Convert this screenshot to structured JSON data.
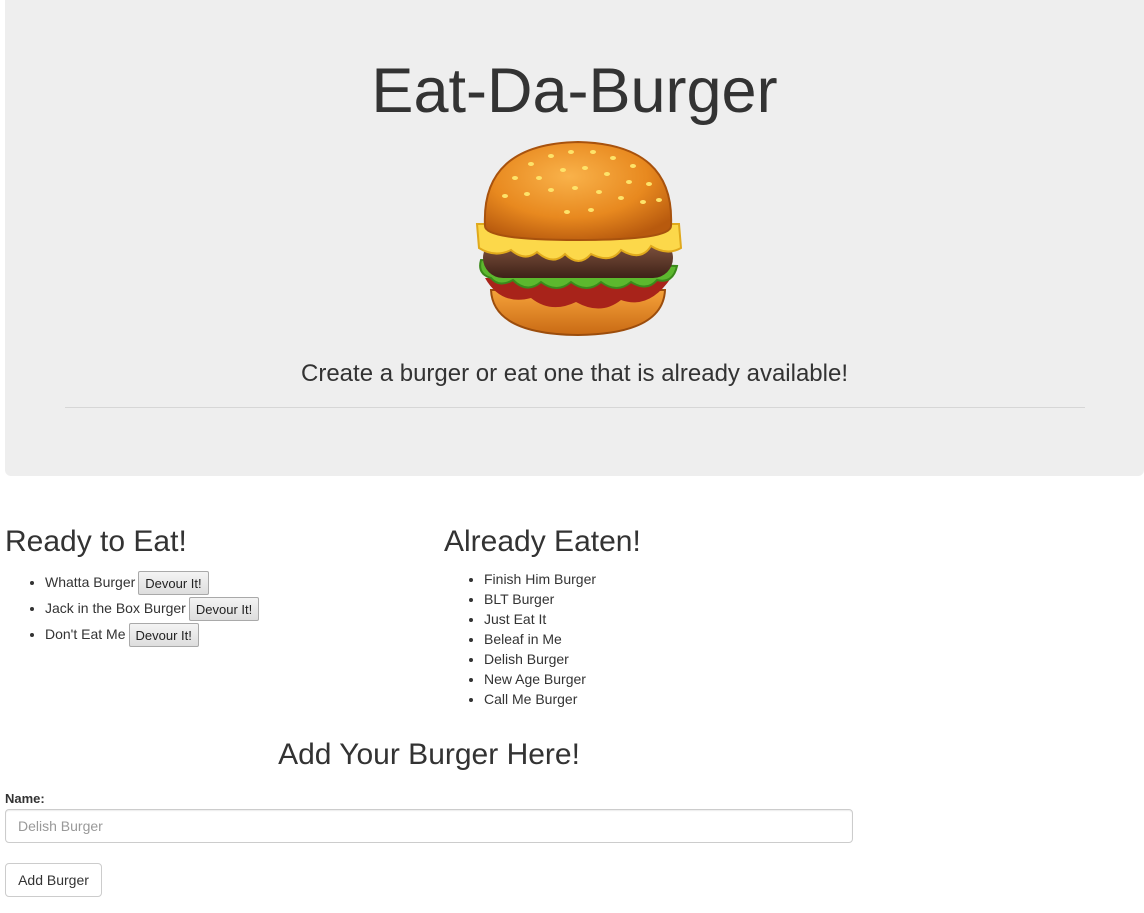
{
  "header": {
    "title": "Eat-Da-Burger",
    "tagline": "Create a burger or eat one that is already available!"
  },
  "logo": {
    "icon": "hamburger-icon"
  },
  "ready": {
    "heading": "Ready to Eat!",
    "items": [
      {
        "name": "Whatta Burger",
        "button": "Devour It!"
      },
      {
        "name": "Jack in the Box Burger",
        "button": "Devour It!"
      },
      {
        "name": "Don't Eat Me",
        "button": "Devour It!"
      }
    ]
  },
  "eaten": {
    "heading": "Already Eaten!",
    "items": [
      "Finish Him Burger",
      "BLT Burger",
      "Just Eat It",
      "Beleaf in Me",
      "Delish Burger",
      "New Age Burger",
      "Call Me Burger"
    ]
  },
  "form": {
    "title": "Add Your Burger Here!",
    "name_label": "Name:",
    "name_placeholder": "Delish Burger",
    "name_value": "",
    "submit_label": "Add Burger"
  },
  "colors": {
    "jumbotron_bg": "#eeeeee",
    "text": "#333333"
  }
}
